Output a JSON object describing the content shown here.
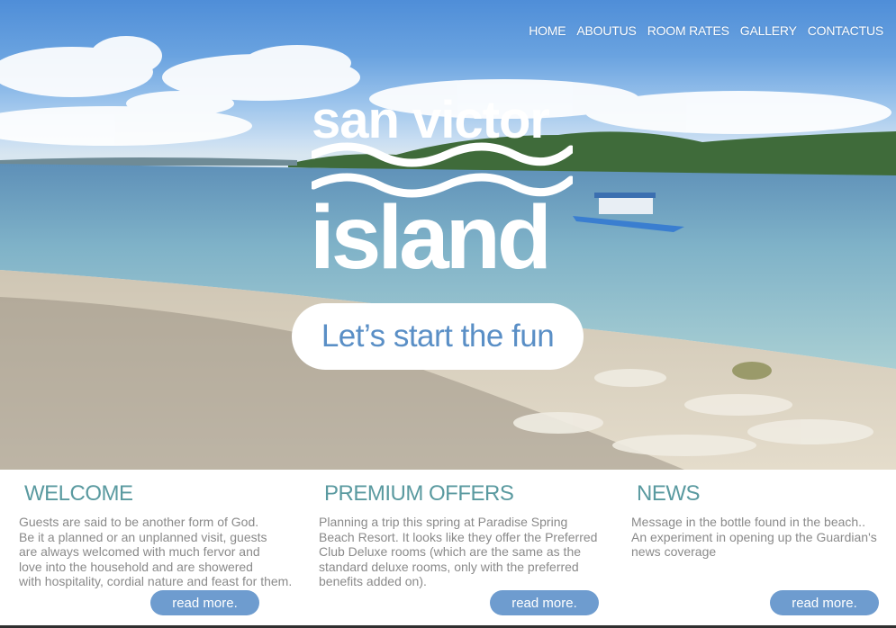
{
  "nav": {
    "items": [
      {
        "label": "HOME"
      },
      {
        "label": "ABOUTUS"
      },
      {
        "label": "ROOM RATES"
      },
      {
        "label": "GALLERY"
      },
      {
        "label": "CONTACTUS"
      }
    ]
  },
  "hero": {
    "logo_line1": "san victor",
    "logo_line2": "island",
    "cta_label": "Let’s start the fun"
  },
  "sections": {
    "welcome": {
      "title": "WELCOME",
      "text": "Guests are said to be another form of God.\nBe it a planned or an unplanned visit, guests\nare always welcomed with much fervor and\nlove into the household and are showered\nwith hospitality, cordial nature and feast for them.",
      "button": "read more."
    },
    "offers": {
      "title": "PREMIUM OFFERS",
      "text": "Planning a trip this spring at Paradise Spring\nBeach Resort. It looks like they offer the Preferred\nClub Deluxe rooms (which are the same as the\nstandard deluxe rooms, only with the preferred\nbenefits added on).",
      "button": "read more."
    },
    "news": {
      "title": "NEWS",
      "text": "Message in the bottle found in the beach..\nAn experiment in opening up the Guardian's\nnews coverage",
      "button": "read more."
    }
  },
  "colors": {
    "accent": "#5a9aa0",
    "button": "#6e9ccf",
    "cta_text": "#5a8fc6"
  }
}
